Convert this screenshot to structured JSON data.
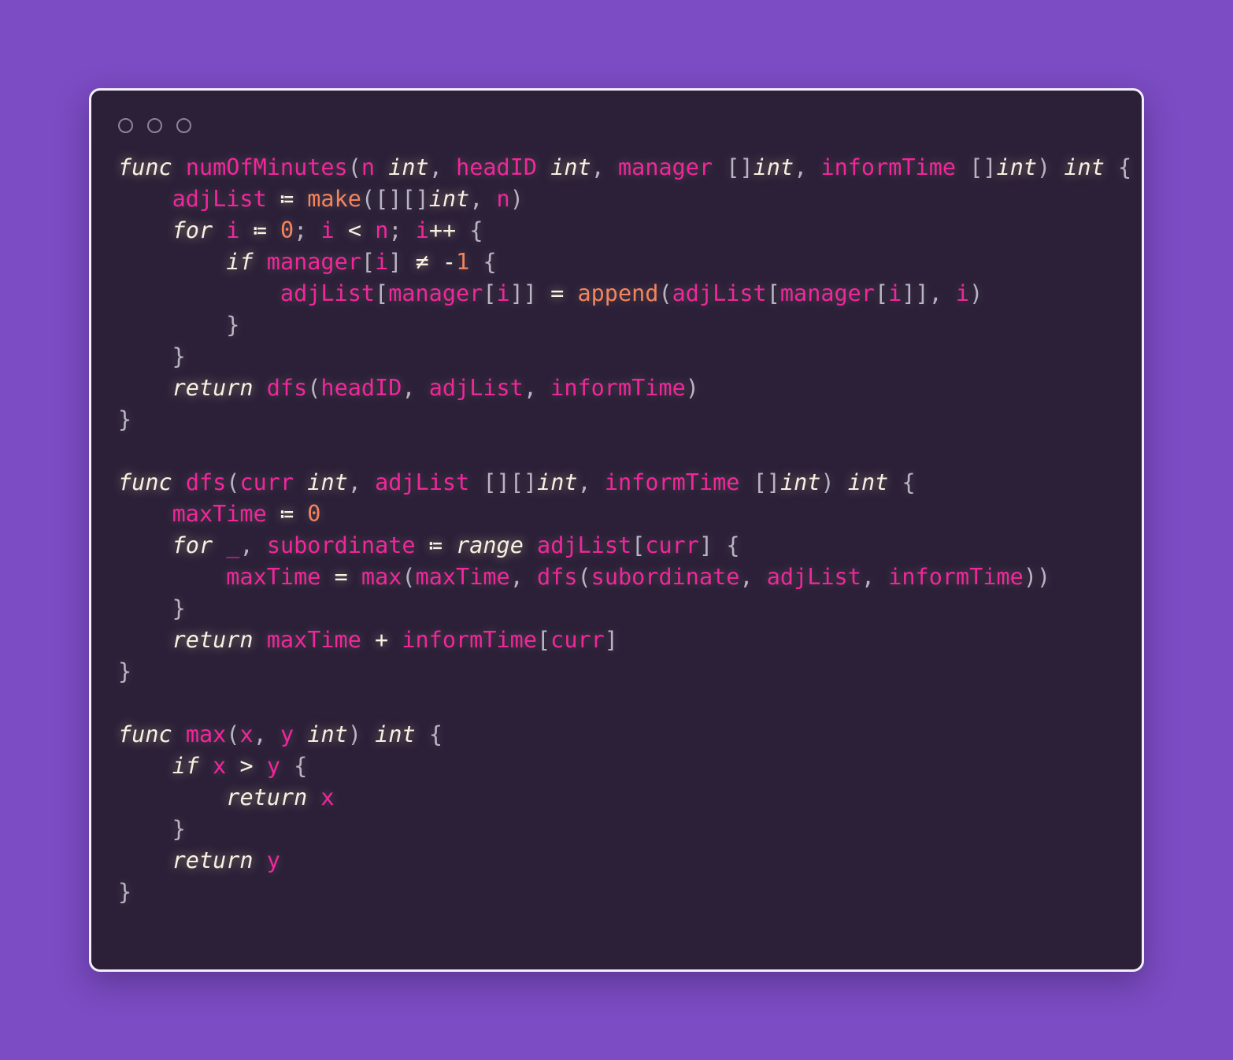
{
  "window": {
    "background_color": "#7b4cc3",
    "surface_color": "#2b2038",
    "border_color": "#f2eef7",
    "traffic_lights": [
      {
        "name": "close",
        "style": "hollow-circle"
      },
      {
        "name": "minimize",
        "style": "hollow-circle"
      },
      {
        "name": "zoom",
        "style": "hollow-circle"
      }
    ]
  },
  "palette": {
    "keyword": "#f5f1e3",
    "identifier": "#f2269b",
    "type": "#f5f1e3",
    "function": "#f5835c",
    "number": "#f5835c",
    "operator": "#f7f2e2",
    "punctuation": "#b9b3c4"
  },
  "code": {
    "language": "go",
    "line_count": 27,
    "lines": [
      "func numOfMinutes(n int, headID int, manager []int, informTime []int) int {",
      "    adjList := make([][]int, n)",
      "    for i := 0; i < n; i++ {",
      "        if manager[i] != -1 {",
      "            adjList[manager[i]] = append(adjList[manager[i]], i)",
      "        }",
      "    }",
      "    return dfs(headID, adjList, informTime)",
      "}",
      "",
      "func dfs(curr int, adjList [][]int, informTime []int) int {",
      "    maxTime := 0",
      "    for _, subordinate := range adjList[curr] {",
      "        maxTime = max(maxTime, dfs(subordinate, adjList, informTime))",
      "    }",
      "    return maxTime + informTime[curr]",
      "}",
      "",
      "func max(x, y int) int {",
      "    if x > y {",
      "        return x",
      "    }",
      "    return y",
      "}"
    ]
  }
}
